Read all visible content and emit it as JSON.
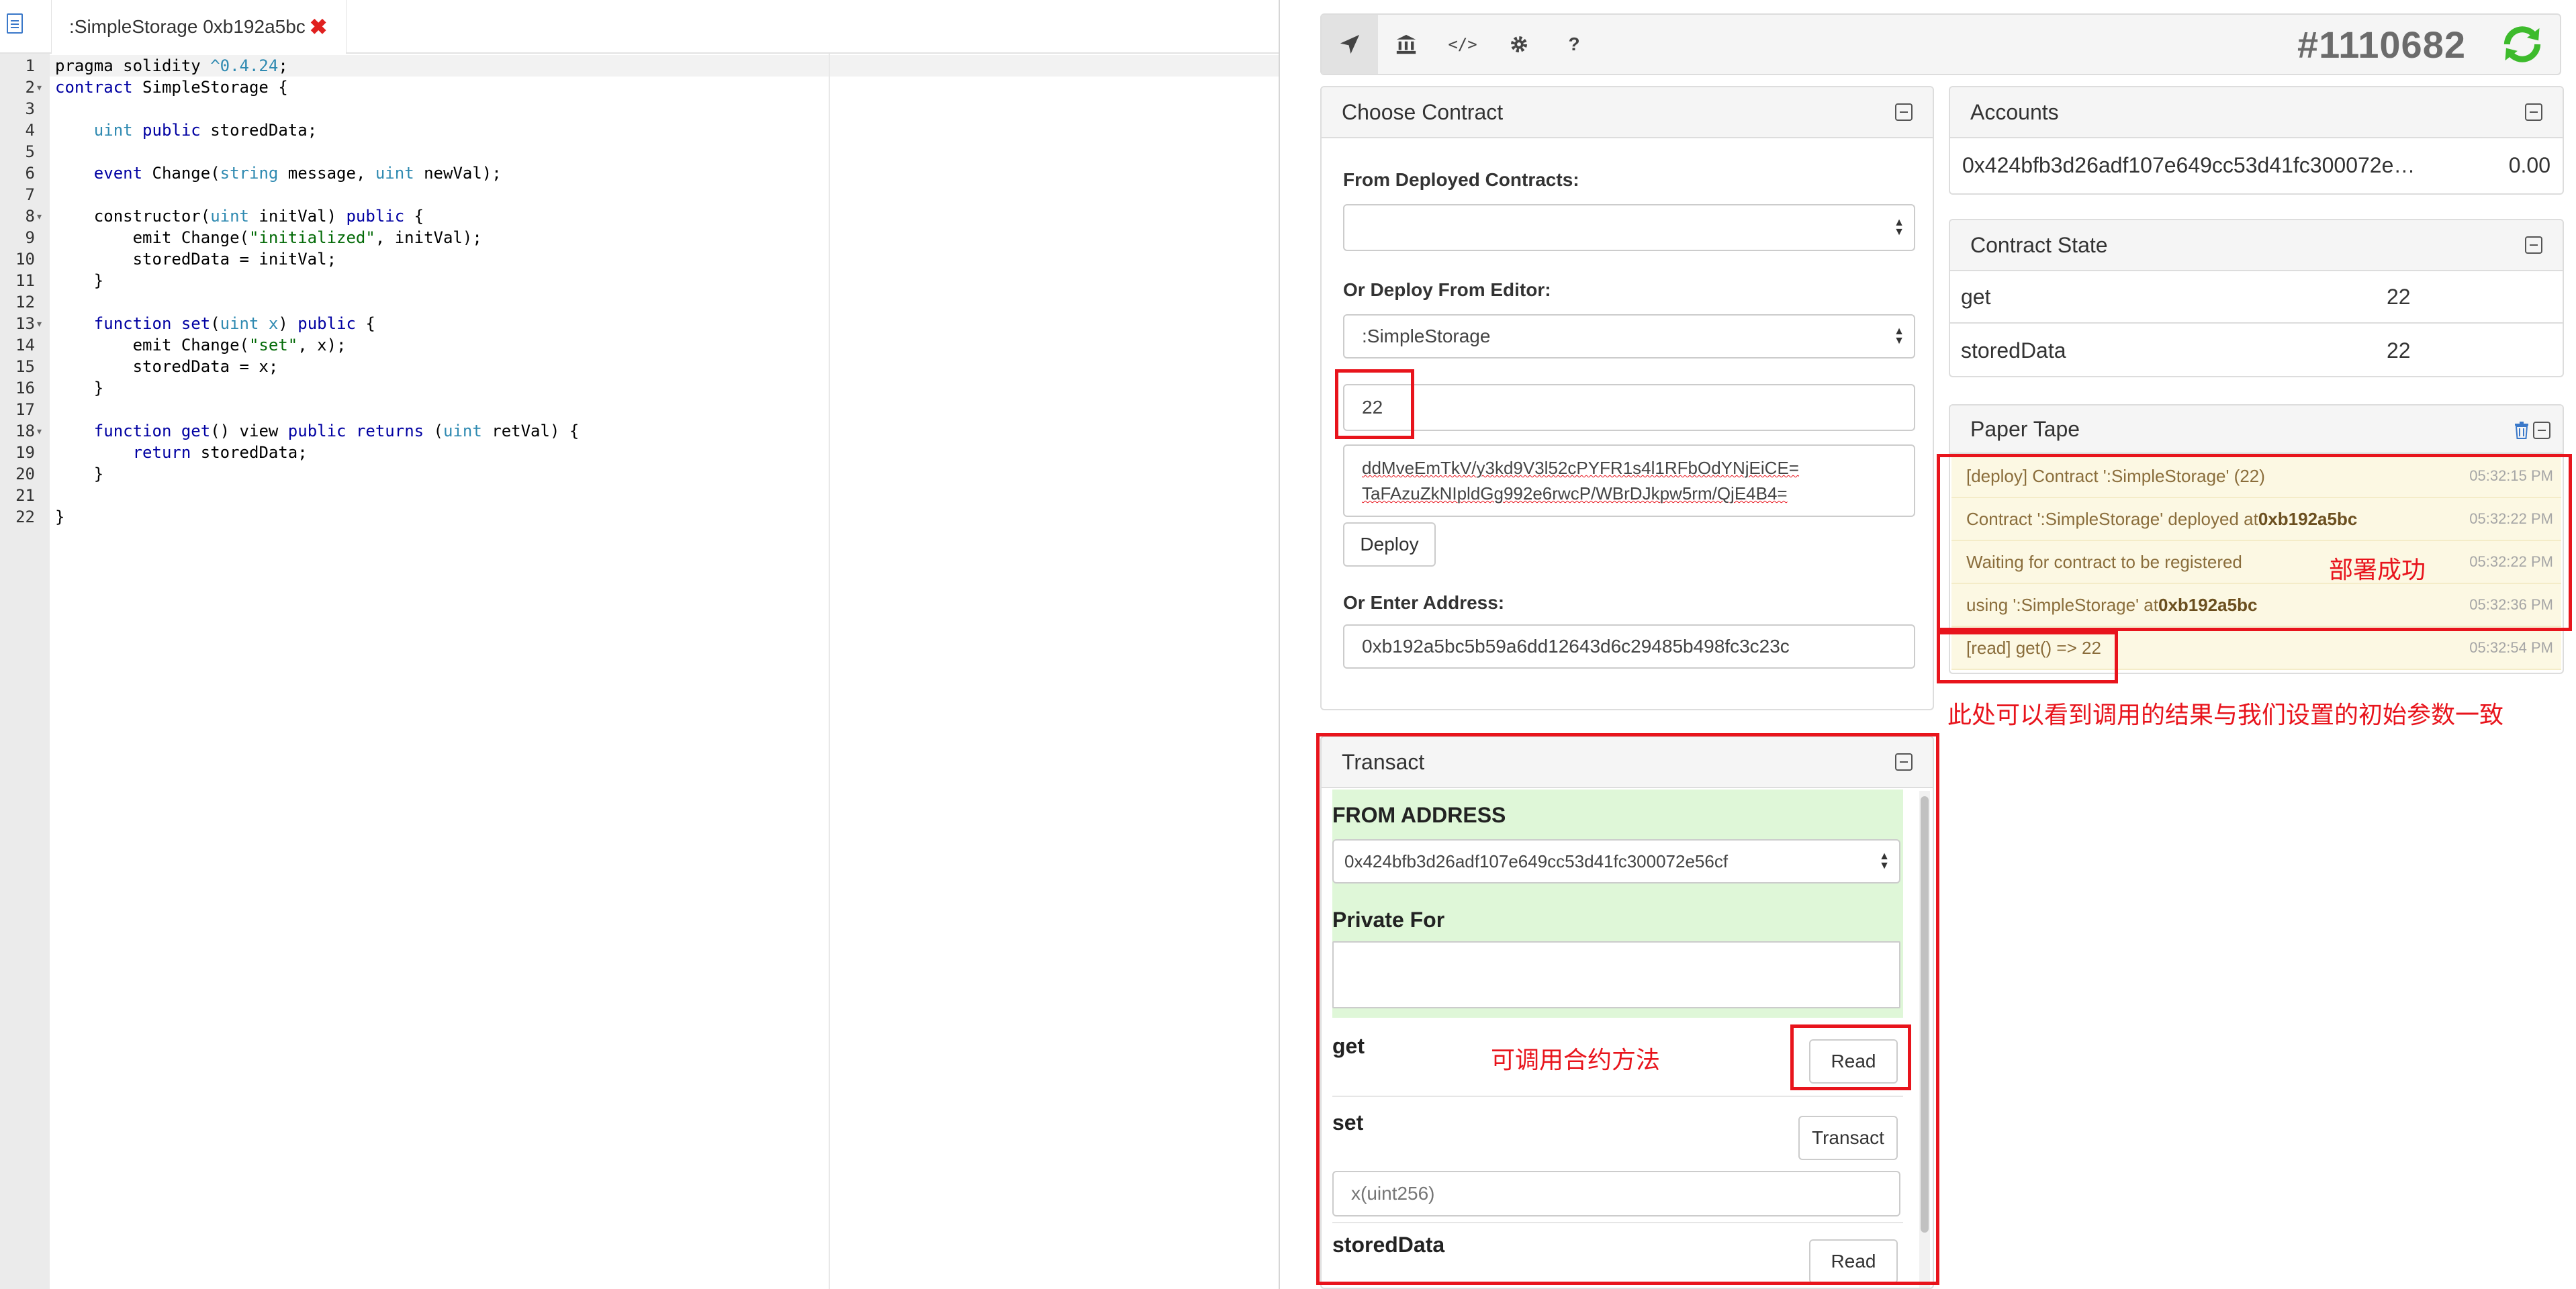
{
  "editor": {
    "tab_title": ":SimpleStorage 0xb192a5bc",
    "tab_close": "✖",
    "lines": [
      {
        "n": "1",
        "fold": "",
        "html": "pragma solidity <span class=\"ty\">^0.4.24</span>;"
      },
      {
        "n": "2",
        "fold": "▾",
        "html": "<span class=\"kw\">contract</span> SimpleStorage {"
      },
      {
        "n": "3",
        "fold": "",
        "html": ""
      },
      {
        "n": "4",
        "fold": "",
        "html": "    <span class=\"ty\">uint</span> <span class=\"kw\">public</span> storedData;"
      },
      {
        "n": "5",
        "fold": "",
        "html": ""
      },
      {
        "n": "6",
        "fold": "",
        "html": "    <span class=\"kw\">event</span> Change(<span class=\"ty\">string</span> message, <span class=\"ty\">uint</span> newVal);"
      },
      {
        "n": "7",
        "fold": "",
        "html": ""
      },
      {
        "n": "8",
        "fold": "▾",
        "html": "    constructor(<span class=\"ty\">uint</span> initVal) <span class=\"kw\">public</span> {"
      },
      {
        "n": "9",
        "fold": "",
        "html": "        emit Change(<span class=\"st\">\"initialized\"</span>, initVal);"
      },
      {
        "n": "10",
        "fold": "",
        "html": "        storedData = initVal;"
      },
      {
        "n": "11",
        "fold": "",
        "html": "    }"
      },
      {
        "n": "12",
        "fold": "",
        "html": ""
      },
      {
        "n": "13",
        "fold": "▾",
        "html": "    <span class=\"kw\">function</span> <span class=\"kw\">set</span>(<span class=\"ty\">uint</span> <span class=\"ty\">x</span>) <span class=\"kw\">public</span> {"
      },
      {
        "n": "14",
        "fold": "",
        "html": "        emit Change(<span class=\"st\">\"set\"</span>, x);"
      },
      {
        "n": "15",
        "fold": "",
        "html": "        storedData = x;"
      },
      {
        "n": "16",
        "fold": "",
        "html": "    }"
      },
      {
        "n": "17",
        "fold": "",
        "html": ""
      },
      {
        "n": "18",
        "fold": "▾",
        "html": "    <span class=\"kw\">function</span> <span class=\"kw\">get</span>() view <span class=\"kw\">public</span> <span class=\"kw\">returns</span> (<span class=\"ty\">uint</span> retVal) {"
      },
      {
        "n": "19",
        "fold": "",
        "html": "        <span class=\"kw\">return</span> storedData;"
      },
      {
        "n": "20",
        "fold": "",
        "html": "    }"
      },
      {
        "n": "21",
        "fold": "",
        "html": ""
      },
      {
        "n": "22",
        "fold": "",
        "html": "}"
      }
    ]
  },
  "toolbar": {
    "buttons": [
      "send-icon",
      "bank-icon",
      "code-icon",
      "gear-icon",
      "help-icon"
    ],
    "code_glyph": "</>",
    "help_glyph": "?",
    "block_number": "#1110682"
  },
  "choose_contract": {
    "title": "Choose Contract",
    "from_deployed_label": "From Deployed Contracts:",
    "from_deployed_value": "",
    "deploy_from_editor_label": "Or Deploy From Editor:",
    "deploy_from_editor_value": ":SimpleStorage",
    "constructor_arg": "22",
    "private_for_line1": "ddMveEmTkV/y3kd9V3l52cPYFR1s4l1RFbOdYNjEiCE=",
    "private_for_line2": "TaFAzuZkNIpldGg992e6rwcP/WBrDJkpw5rm/QjE4B4=",
    "deploy_button": "Deploy",
    "enter_address_label": "Or Enter Address:",
    "enter_address_value": "0xb192a5bc5b59a6dd12643d6c29485b498fc3c23c"
  },
  "accounts": {
    "title": "Accounts",
    "address": "0x424bfb3d26adf107e649cc53d41fc300072e…",
    "balance": "0.00"
  },
  "contract_state": {
    "title": "Contract State",
    "rows": [
      {
        "name": "get",
        "value": "22"
      },
      {
        "name": "storedData",
        "value": "22"
      }
    ]
  },
  "paper_tape": {
    "title": "Paper Tape",
    "rows": [
      {
        "text": "[deploy] Contract ':SimpleStorage' (22)",
        "bold": "",
        "time": "05:32:15 PM"
      },
      {
        "text": "Contract ':SimpleStorage' deployed at ",
        "bold": "0xb192a5bc",
        "time": "05:32:22 PM"
      },
      {
        "text": "Waiting for contract to be registered",
        "bold": "",
        "time": "05:32:22 PM"
      },
      {
        "text": "using ':SimpleStorage' at ",
        "bold": "0xb192a5bc",
        "time": "05:32:36 PM"
      },
      {
        "text": "[read] get() => 22",
        "bold": "",
        "time": "05:32:54 PM"
      }
    ]
  },
  "transact": {
    "title": "Transact",
    "from_address_label": "FROM ADDRESS",
    "from_address_value": "0x424bfb3d26adf107e649cc53d41fc300072e56cf",
    "private_for_label": "Private For",
    "private_for_value": "",
    "methods": [
      {
        "name": "get",
        "button": "Read",
        "input_placeholder": ""
      },
      {
        "name": "set",
        "button": "Transact",
        "input_placeholder": "x(uint256)"
      },
      {
        "name": "storedData",
        "button": "Read",
        "input_placeholder": ""
      }
    ]
  },
  "annotations": {
    "deploy_success": "部署成功",
    "callable_methods": "可调用合约方法",
    "result_note": "此处可以看到调用的结果与我们设置的初始参数一致"
  },
  "colors": {
    "annotation_red": "#e8141c",
    "refresh_green": "#3dbb2c",
    "tape_bg": "#fcf8e3",
    "tape_text": "#8a6d3b",
    "transact_green": "#dff7d8"
  }
}
